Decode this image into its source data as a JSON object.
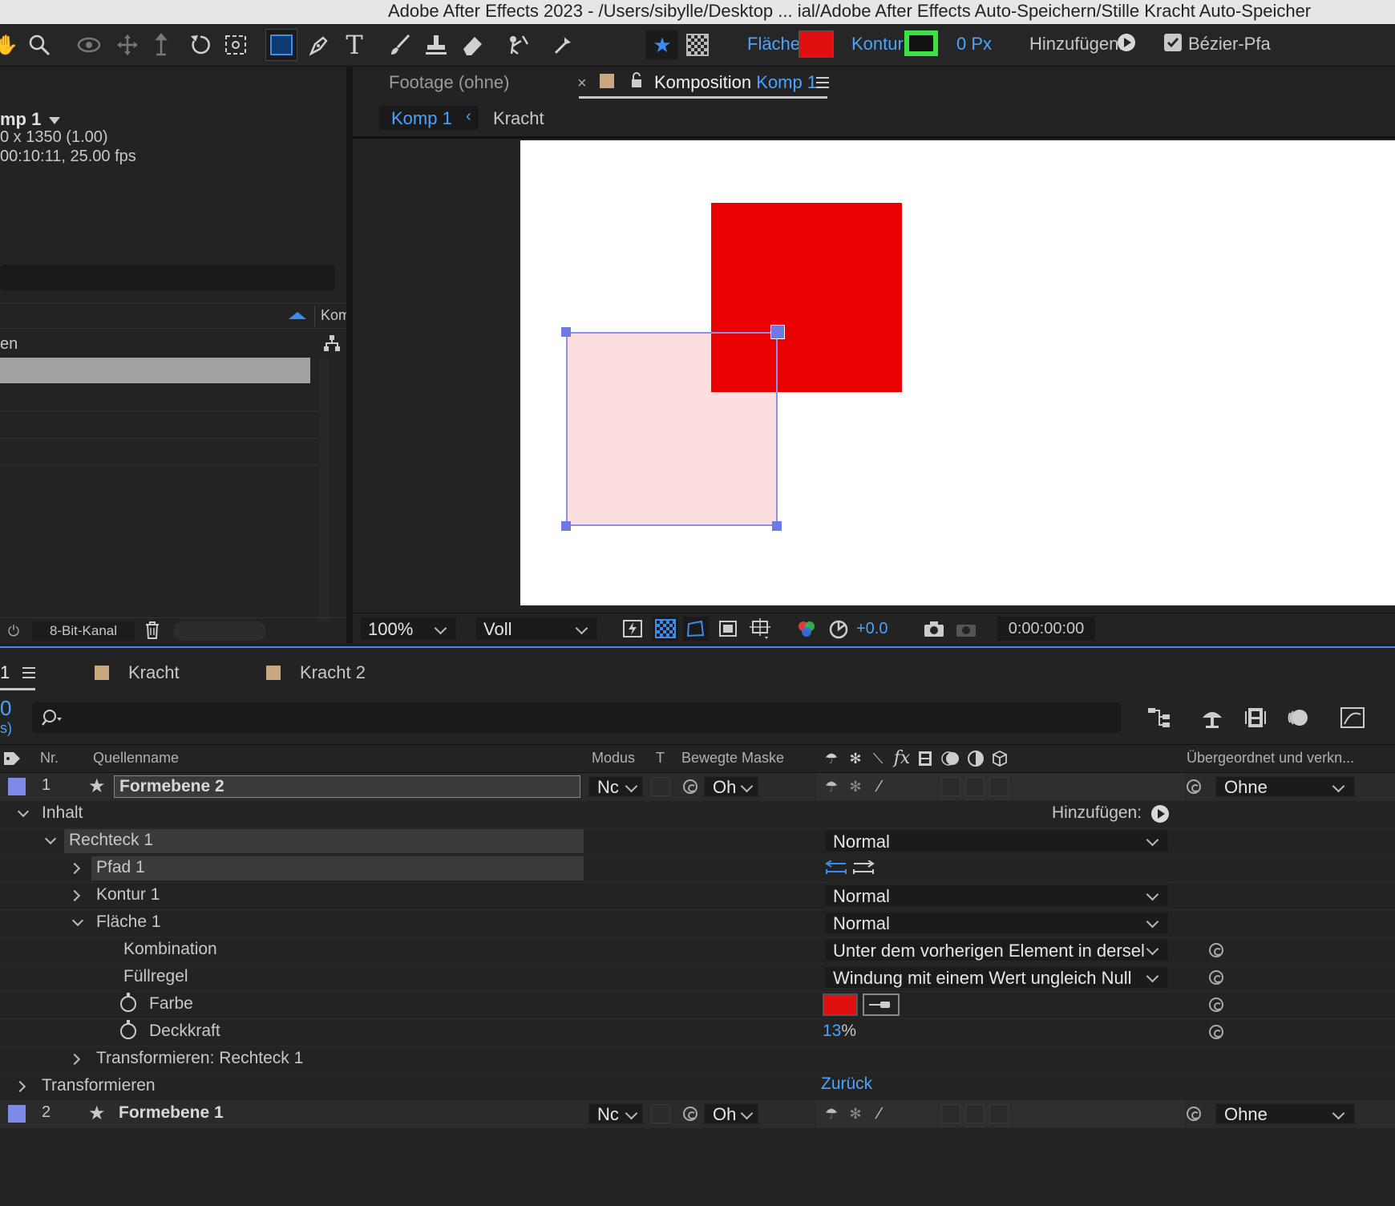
{
  "window": {
    "title": "Adobe After Effects 2023 - /Users/sibylle/Desktop ... ial/Adobe After Effects Auto-Speichern/Stille Kracht Auto-Speicher"
  },
  "toolbar": {
    "fill_label": "Fläche:",
    "stroke_label": "Kontur:",
    "stroke_width": "0 Px",
    "add_label": "Hinzufügen:",
    "bezier_label": "Bézier-Pfa",
    "fill_color": "#e01010",
    "stroke_color": "#3de043"
  },
  "project_panel": {
    "comp_name": "mp 1",
    "comp_size": "0 x 1350 (1.00)",
    "comp_duration": "00:10:11, 25.00 fps",
    "col_header": "Kom",
    "name_col": "en",
    "bit_depth": "8-Bit-Kanal"
  },
  "viewer": {
    "tab_footage": "Footage (ohne)",
    "tab_comp_prefix": "Komposition",
    "tab_comp_name": "Komp 1",
    "breadcrumb_active": "Komp 1",
    "breadcrumb_next": "Kracht",
    "zoom": "100%",
    "resolution": "Voll",
    "exposure": "+0.0",
    "timecode": "0:00:00:00"
  },
  "timeline": {
    "tab_active": "1",
    "tabs": [
      "Kracht",
      "Kracht 2"
    ],
    "timecode_fragment": "0",
    "fps_fragment": "s)",
    "columns": {
      "nr": "Nr.",
      "source": "Quellenname",
      "mode": "Modus",
      "t": "T",
      "matte": "Bewegte Maske",
      "parent": "Übergeordnet und verkn..."
    },
    "layers": [
      {
        "nr": "1",
        "name": "Formebene 2",
        "mode": "Nc",
        "matte": "Oh",
        "parent": "Ohne",
        "color": "#7f8be8"
      },
      {
        "nr": "2",
        "name": "Formebene 1",
        "mode": "Nc",
        "matte": "Oh",
        "parent": "Ohne",
        "color": "#7f8be8"
      }
    ],
    "tree": {
      "contents": "Inhalt",
      "add_label": "Hinzufügen:",
      "rect": "Rechteck 1",
      "rect_mode": "Normal",
      "path": "Pfad 1",
      "stroke": "Kontur 1",
      "stroke_mode": "Normal",
      "fill": "Fläche 1",
      "fill_mode": "Normal",
      "composite_label": "Kombination",
      "composite_value": "Unter dem vorherigen Element in dersel",
      "fill_rule_label": "Füllregel",
      "fill_rule_value": "Windung mit einem Wert ungleich Null",
      "color_label": "Farbe",
      "color_value": "#e01010",
      "opacity_label": "Deckkraft",
      "opacity_value": "13",
      "opacity_unit": "%",
      "transform_rect": "Transformieren: Rechteck 1",
      "transform": "Transformieren",
      "reset": "Zurück"
    }
  }
}
